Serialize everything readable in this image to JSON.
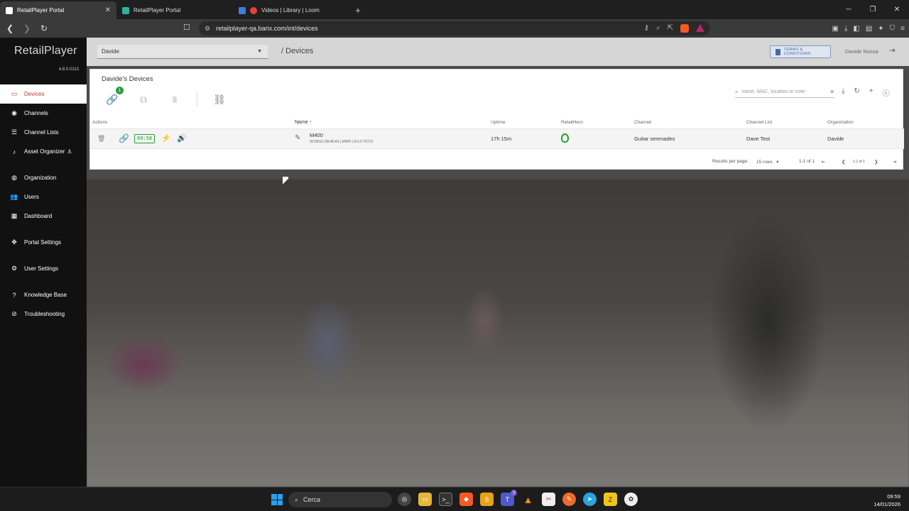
{
  "browser": {
    "tabs": [
      {
        "title": "RetailPlayer Portal",
        "active": true
      },
      {
        "title": "RetailPlayer Portal",
        "active": false
      },
      {
        "title": "Videos | Library | Loom",
        "active": false
      }
    ],
    "url": "retailplayer-qa.barix.com/int/devices"
  },
  "app": {
    "brand": "RetailPlayer",
    "version": "4.8.0-0113",
    "nav": [
      {
        "label": "Devices",
        "icon": "devices-icon",
        "active": true
      },
      {
        "label": "Channels",
        "icon": "broadcast-icon"
      },
      {
        "label": "Channel Lists",
        "icon": "list-icon"
      },
      {
        "label": "Asset Organizer",
        "icon": "music-note-icon"
      },
      {
        "label": "Organization",
        "icon": "globe-icon"
      },
      {
        "label": "Users",
        "icon": "users-icon"
      },
      {
        "label": "Dashboard",
        "icon": "dashboard-icon"
      },
      {
        "label": "Portal Settings",
        "icon": "portal-settings-icon"
      },
      {
        "label": "User Settings",
        "icon": "gear-icon"
      },
      {
        "label": "Knowledge Base",
        "icon": "help-icon"
      },
      {
        "label": "Troubleshooting",
        "icon": "compass-icon"
      }
    ],
    "org_select": "Davide",
    "breadcrumb": "/ Devices",
    "terms_label": "TERMS & CONDITIONS",
    "user_name": "Davide Nossa",
    "panel_title": "Davide's Devices",
    "connected_badge": "1",
    "search_placeholder": "name, MAC, location or note:",
    "columns": {
      "actions": "Actions",
      "name": "Name",
      "uptime": "Uptime",
      "retailhero": "RetailHero",
      "channel": "Channel",
      "channel_list": "Channel List",
      "organization": "Organization"
    },
    "rows": [
      {
        "timer": "09:58",
        "name": "M400",
        "sub": "00:08:E1:08:46:A9 | M400 | 8.0.0-T5713",
        "uptime": "17h 15m",
        "channel": "Guitar serenades",
        "channel_list": "Dave Test",
        "organization": "Davide"
      }
    ],
    "pager": {
      "results_label": "Results per page:",
      "rows_value": "15 rows",
      "range": "1-1 of 1",
      "mini_range": "1-1 of 1"
    }
  },
  "taskbar": {
    "search_label": "Cerca",
    "teams_badge": "3",
    "time": "09:59",
    "date": "14/01/2026"
  },
  "colors": {
    "accent_red": "#c0392b",
    "status_green": "#27a02f",
    "terms_blue": "#4667a8"
  }
}
